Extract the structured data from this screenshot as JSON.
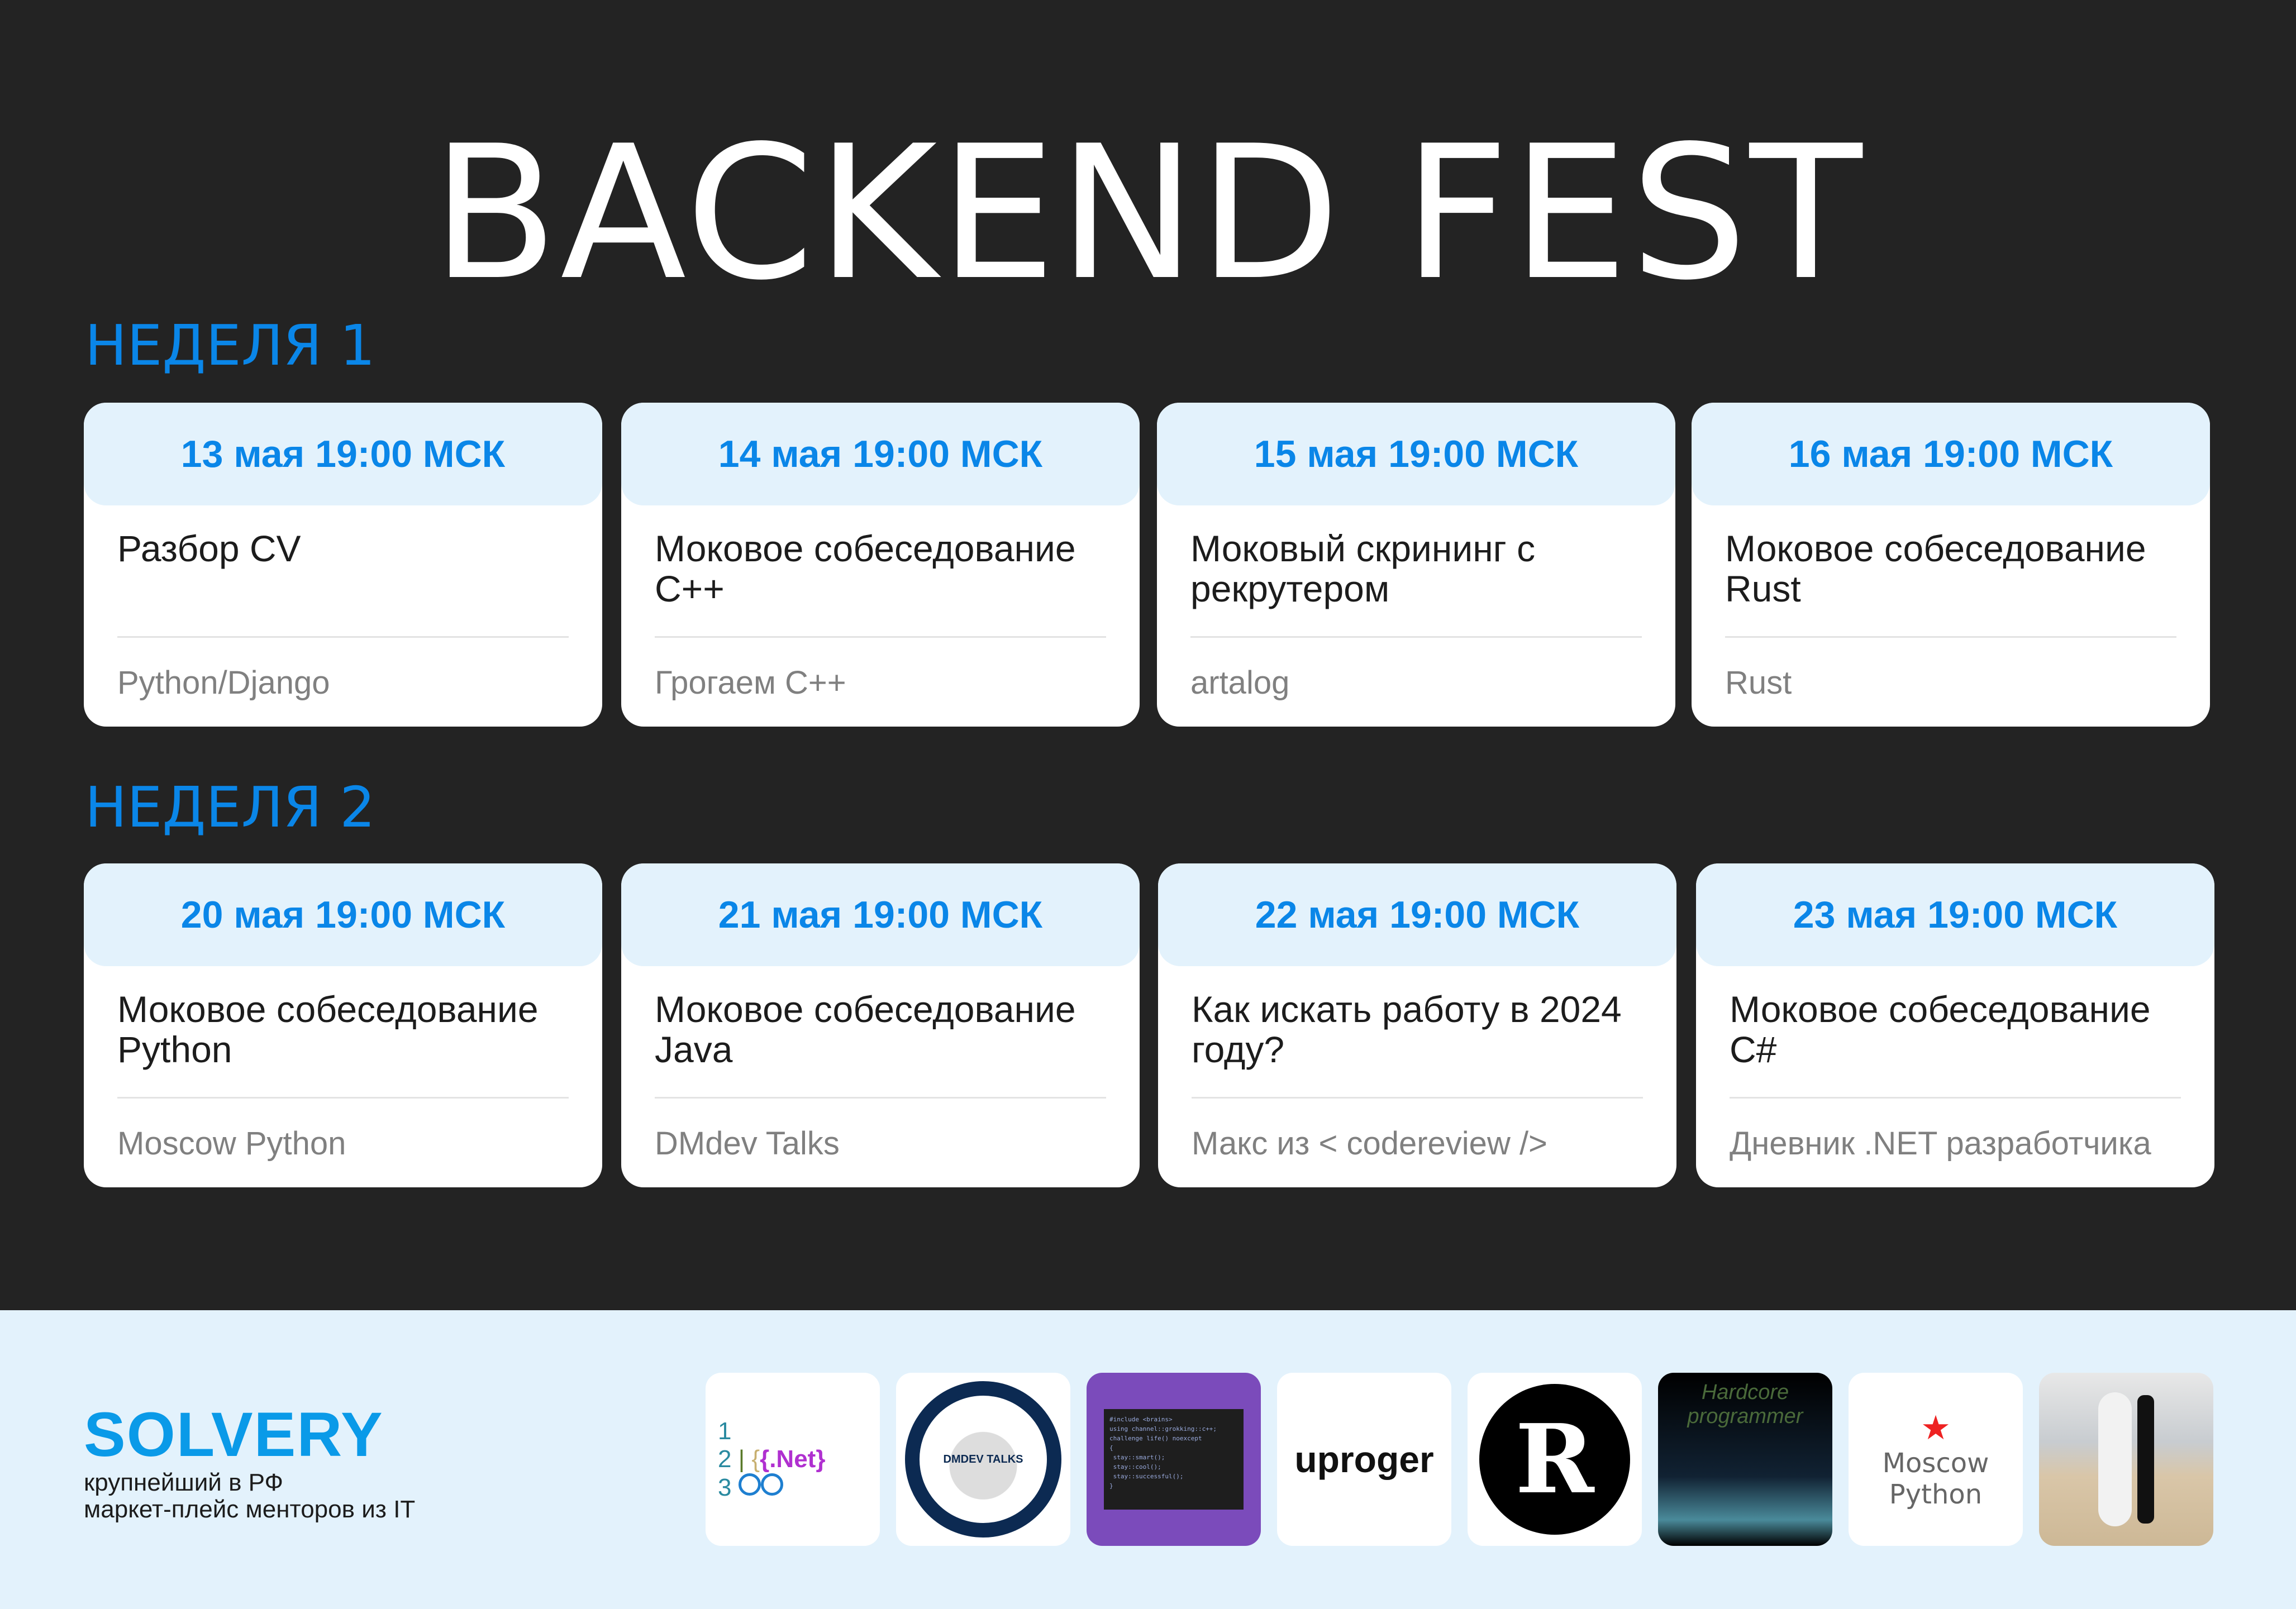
{
  "title": "BACKEND FEST",
  "weeks": [
    {
      "label": "НЕДЕЛЯ 1",
      "events": [
        {
          "date": "13 мая 19:00 МСК",
          "name": "Разбор CV",
          "speaker": "Python/Django"
        },
        {
          "date": "14 мая 19:00 МСК",
          "name": "Моковое собеседование С++",
          "speaker": "Грогаем С++"
        },
        {
          "date": "15 мая 19:00 МСК",
          "name": "Моковый скрининг с рекрутером",
          "speaker": "artalog"
        },
        {
          "date": "16 мая 19:00 МСК",
          "name": "Моковое собеседование Rust",
          "speaker": "Rust"
        }
      ]
    },
    {
      "label": "НЕДЕЛЯ 2",
      "events": [
        {
          "date": "20 мая 19:00 МСК",
          "name": "Моковое собеседование Python",
          "speaker": "Moscow Python"
        },
        {
          "date": "21 мая 19:00 МСК",
          "name": "Моковое собеседование Java",
          "speaker": "DMdev Talks"
        },
        {
          "date": "22 мая 19:00 МСК",
          "name": "Как искать работу в 2024 году?",
          "speaker": "Макс из < codereview />"
        },
        {
          "date": "23 мая 19:00 МСК",
          "name": "Моковое собеседование C#",
          "speaker": "Дневник .NET разработчика"
        }
      ]
    }
  ],
  "footer": {
    "brand": "SOLVERY",
    "tagline_1": "крупнейший в РФ",
    "tagline_2": "маркет-плейс менторов из IT",
    "logos": [
      {
        "icon": "dotnet-diary-logo",
        "text": "{.Net}"
      },
      {
        "icon": "dmdev-talks-logo",
        "text": "DMDEV TALKS"
      },
      {
        "icon": "grokking-cpp-logo"
      },
      {
        "icon": "uproger-logo",
        "text": "uproger"
      },
      {
        "icon": "rust-logo"
      },
      {
        "icon": "hardcore-programmer-logo",
        "text": "Hardcore programmer"
      },
      {
        "icon": "moscow-python-logo",
        "text": "Moscow Python"
      },
      {
        "icon": "surfer-photo"
      }
    ]
  },
  "colors": {
    "accent": "#0a86e8",
    "background": "#232323",
    "card_header": "#e3f2fc"
  }
}
